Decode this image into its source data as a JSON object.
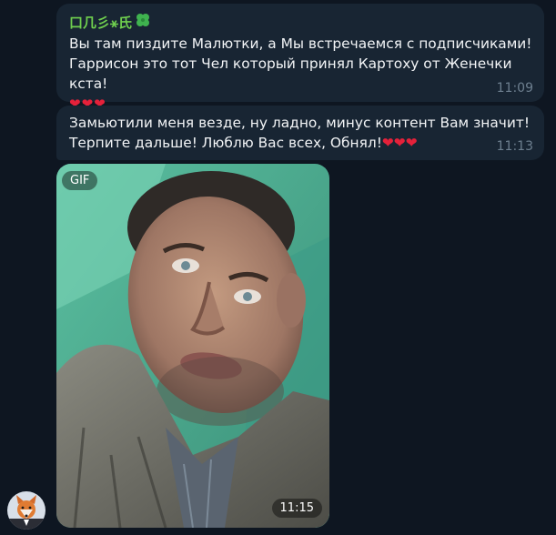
{
  "messages": [
    {
      "sender": "口几彡⚹氏",
      "text": "Вы там пиздите Малютки, а Мы встречаемся с подписчиками!\nГаррисон это тот Чел который принял Картоху от Женечки кста!",
      "hearts": "❤❤❤",
      "time": "11:09"
    },
    {
      "text": "Замьютили меня везде, ну ладно, минус контент Вам значит!\nТерпите дальше! Люблю Вас всех, Обнял!❤❤❤",
      "time": "11:13"
    },
    {
      "type": "gif",
      "badge": "GIF",
      "time": "11:15"
    }
  ],
  "icons": {
    "sender_badge": "four-leaf-clover-icon",
    "avatar": "fox-avatar"
  },
  "colors": {
    "background": "#0e1621",
    "bubble": "#182533",
    "sender_name": "#6fcf4e",
    "time": "#6d7f8f",
    "heart": "#e5213a"
  }
}
